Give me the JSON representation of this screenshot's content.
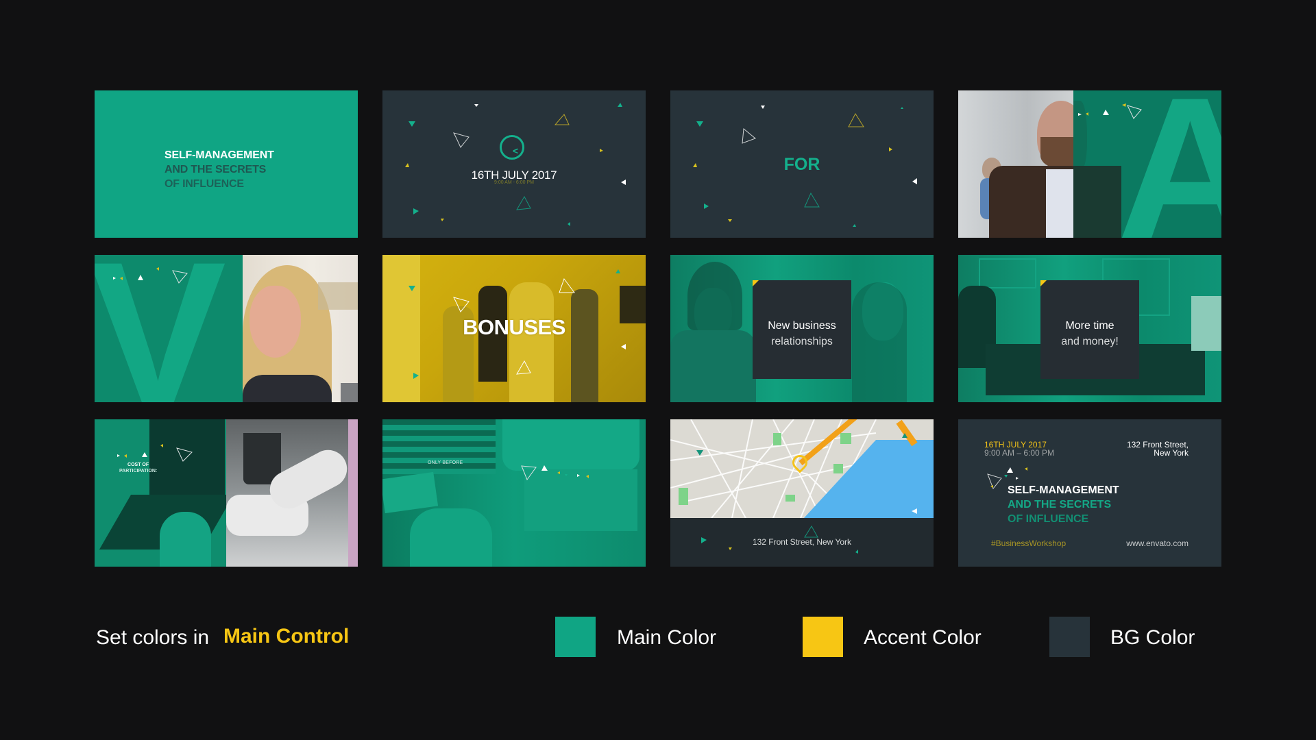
{
  "colors": {
    "background": "#111112",
    "main": "#10a584",
    "accent": "#f7c614",
    "bg": "#27333a"
  },
  "tiles": [
    {
      "id": 1,
      "type": "title",
      "lines": [
        "SELF-MANAGEMENT",
        "AND THE SECRETS",
        "OF INFLUENCE"
      ]
    },
    {
      "id": 2,
      "type": "date",
      "date": "16TH JULY 2017",
      "time": "9:00 AM - 6:00 PM",
      "icon": "clock-icon"
    },
    {
      "id": 3,
      "type": "word",
      "text": "FOR"
    },
    {
      "id": 4,
      "type": "speaker-letter",
      "letter": "A"
    },
    {
      "id": 5,
      "type": "speaker-letter",
      "letter": "V"
    },
    {
      "id": 6,
      "type": "word-photo",
      "text": "BONUSES"
    },
    {
      "id": 7,
      "type": "card",
      "lines": [
        "New business",
        "relationships"
      ]
    },
    {
      "id": 8,
      "type": "card",
      "lines": [
        "More time",
        "and money!"
      ]
    },
    {
      "id": 9,
      "type": "split-photo",
      "lines": [
        "COST OF",
        "PARTICIPATION:"
      ]
    },
    {
      "id": 10,
      "type": "photo",
      "text": "ONLY BEFORE"
    },
    {
      "id": 11,
      "type": "map",
      "address": "132 Front Street, New York",
      "icon": "map-pin-icon"
    },
    {
      "id": 12,
      "type": "summary",
      "date": "16TH JULY 2017",
      "time": "9:00 AM – 6:00 PM",
      "address_lines": [
        "132 Front Street,",
        "New York"
      ],
      "title_lines": [
        "SELF-MANAGEMENT",
        "AND THE SECRETS",
        "OF INFLUENCE"
      ],
      "hashtag": "#BusinessWorkshop",
      "website": "www.envato.com"
    }
  ],
  "legend": {
    "prefix": "Set colors in",
    "emphasis": "Main Control",
    "items": [
      {
        "label": "Main Color",
        "color": "#10a584"
      },
      {
        "label": "Accent Color",
        "color": "#f7c614"
      },
      {
        "label": "BG Color",
        "color": "#27333a"
      }
    ]
  }
}
